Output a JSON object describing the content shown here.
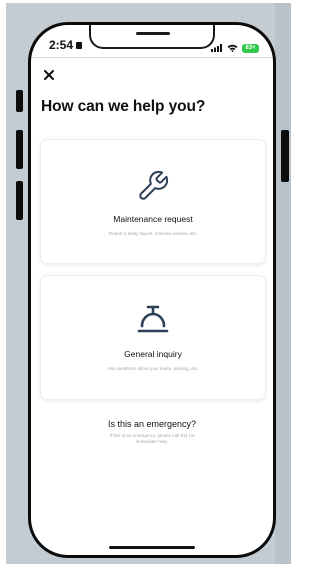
{
  "status_bar": {
    "time": "2:54",
    "battery": "83+"
  },
  "header": {
    "close_label": "✕",
    "title": "How can we help you?"
  },
  "options": [
    {
      "title": "Maintenance request",
      "subtitle": "Report a leaky faucet, cracked window, etc.",
      "icon": "wrench-icon"
    },
    {
      "title": "General inquiry",
      "subtitle": "Ask questions about your lease, parking, etc.",
      "icon": "service-bell-icon"
    }
  ],
  "emergency": {
    "title": "Is this an emergency?",
    "line1": "If this is an emergency, please call 911 for",
    "line2": "immediate help."
  },
  "colors": {
    "icon": "#2e4057",
    "battery": "#32c94a",
    "subtext": "#a3a8ad"
  }
}
